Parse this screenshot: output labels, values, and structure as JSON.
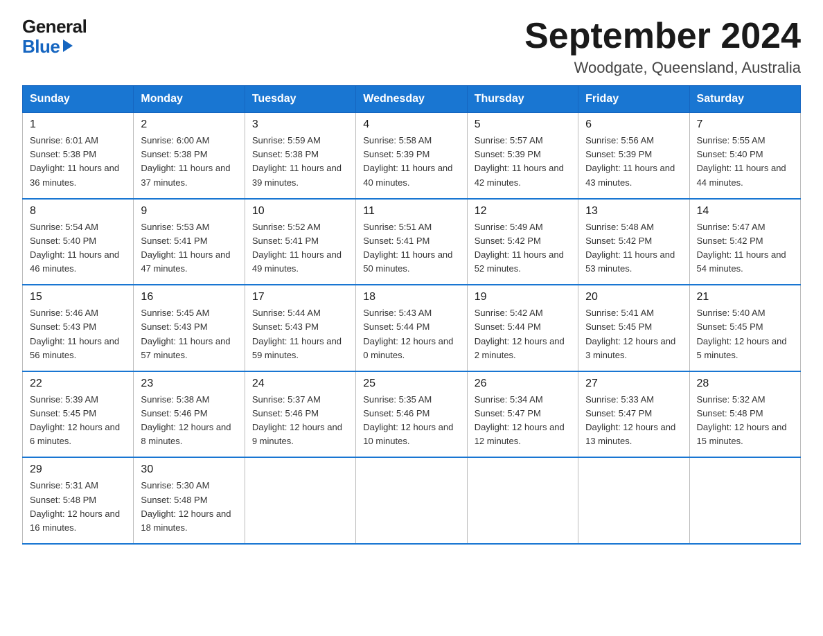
{
  "logo": {
    "general": "General",
    "blue": "Blue"
  },
  "title": "September 2024",
  "location": "Woodgate, Queensland, Australia",
  "days_of_week": [
    "Sunday",
    "Monday",
    "Tuesday",
    "Wednesday",
    "Thursday",
    "Friday",
    "Saturday"
  ],
  "weeks": [
    [
      {
        "day": "1",
        "sunrise": "6:01 AM",
        "sunset": "5:38 PM",
        "daylight": "11 hours and 36 minutes."
      },
      {
        "day": "2",
        "sunrise": "6:00 AM",
        "sunset": "5:38 PM",
        "daylight": "11 hours and 37 minutes."
      },
      {
        "day": "3",
        "sunrise": "5:59 AM",
        "sunset": "5:38 PM",
        "daylight": "11 hours and 39 minutes."
      },
      {
        "day": "4",
        "sunrise": "5:58 AM",
        "sunset": "5:39 PM",
        "daylight": "11 hours and 40 minutes."
      },
      {
        "day": "5",
        "sunrise": "5:57 AM",
        "sunset": "5:39 PM",
        "daylight": "11 hours and 42 minutes."
      },
      {
        "day": "6",
        "sunrise": "5:56 AM",
        "sunset": "5:39 PM",
        "daylight": "11 hours and 43 minutes."
      },
      {
        "day": "7",
        "sunrise": "5:55 AM",
        "sunset": "5:40 PM",
        "daylight": "11 hours and 44 minutes."
      }
    ],
    [
      {
        "day": "8",
        "sunrise": "5:54 AM",
        "sunset": "5:40 PM",
        "daylight": "11 hours and 46 minutes."
      },
      {
        "day": "9",
        "sunrise": "5:53 AM",
        "sunset": "5:41 PM",
        "daylight": "11 hours and 47 minutes."
      },
      {
        "day": "10",
        "sunrise": "5:52 AM",
        "sunset": "5:41 PM",
        "daylight": "11 hours and 49 minutes."
      },
      {
        "day": "11",
        "sunrise": "5:51 AM",
        "sunset": "5:41 PM",
        "daylight": "11 hours and 50 minutes."
      },
      {
        "day": "12",
        "sunrise": "5:49 AM",
        "sunset": "5:42 PM",
        "daylight": "11 hours and 52 minutes."
      },
      {
        "day": "13",
        "sunrise": "5:48 AM",
        "sunset": "5:42 PM",
        "daylight": "11 hours and 53 minutes."
      },
      {
        "day": "14",
        "sunrise": "5:47 AM",
        "sunset": "5:42 PM",
        "daylight": "11 hours and 54 minutes."
      }
    ],
    [
      {
        "day": "15",
        "sunrise": "5:46 AM",
        "sunset": "5:43 PM",
        "daylight": "11 hours and 56 minutes."
      },
      {
        "day": "16",
        "sunrise": "5:45 AM",
        "sunset": "5:43 PM",
        "daylight": "11 hours and 57 minutes."
      },
      {
        "day": "17",
        "sunrise": "5:44 AM",
        "sunset": "5:43 PM",
        "daylight": "11 hours and 59 minutes."
      },
      {
        "day": "18",
        "sunrise": "5:43 AM",
        "sunset": "5:44 PM",
        "daylight": "12 hours and 0 minutes."
      },
      {
        "day": "19",
        "sunrise": "5:42 AM",
        "sunset": "5:44 PM",
        "daylight": "12 hours and 2 minutes."
      },
      {
        "day": "20",
        "sunrise": "5:41 AM",
        "sunset": "5:45 PM",
        "daylight": "12 hours and 3 minutes."
      },
      {
        "day": "21",
        "sunrise": "5:40 AM",
        "sunset": "5:45 PM",
        "daylight": "12 hours and 5 minutes."
      }
    ],
    [
      {
        "day": "22",
        "sunrise": "5:39 AM",
        "sunset": "5:45 PM",
        "daylight": "12 hours and 6 minutes."
      },
      {
        "day": "23",
        "sunrise": "5:38 AM",
        "sunset": "5:46 PM",
        "daylight": "12 hours and 8 minutes."
      },
      {
        "day": "24",
        "sunrise": "5:37 AM",
        "sunset": "5:46 PM",
        "daylight": "12 hours and 9 minutes."
      },
      {
        "day": "25",
        "sunrise": "5:35 AM",
        "sunset": "5:46 PM",
        "daylight": "12 hours and 10 minutes."
      },
      {
        "day": "26",
        "sunrise": "5:34 AM",
        "sunset": "5:47 PM",
        "daylight": "12 hours and 12 minutes."
      },
      {
        "day": "27",
        "sunrise": "5:33 AM",
        "sunset": "5:47 PM",
        "daylight": "12 hours and 13 minutes."
      },
      {
        "day": "28",
        "sunrise": "5:32 AM",
        "sunset": "5:48 PM",
        "daylight": "12 hours and 15 minutes."
      }
    ],
    [
      {
        "day": "29",
        "sunrise": "5:31 AM",
        "sunset": "5:48 PM",
        "daylight": "12 hours and 16 minutes."
      },
      {
        "day": "30",
        "sunrise": "5:30 AM",
        "sunset": "5:48 PM",
        "daylight": "12 hours and 18 minutes."
      },
      null,
      null,
      null,
      null,
      null
    ]
  ],
  "labels": {
    "sunrise": "Sunrise:",
    "sunset": "Sunset:",
    "daylight": "Daylight:"
  },
  "colors": {
    "header_bg": "#1976d2",
    "header_border": "#1565c0",
    "row_border": "#1976d2"
  }
}
